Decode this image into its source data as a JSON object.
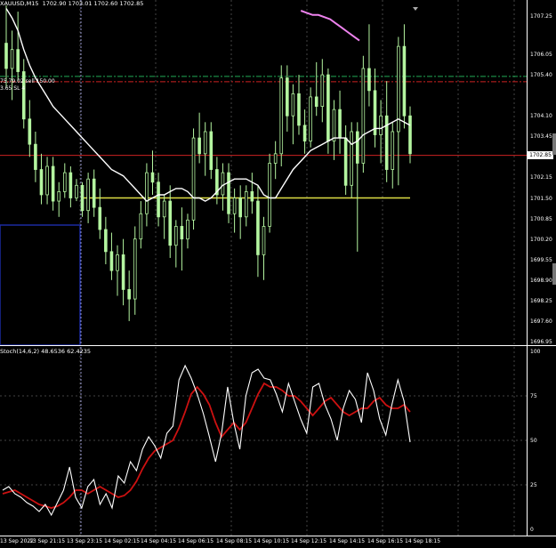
{
  "window": {
    "symbol_title": "XAUUSD,M15",
    "ohlc": "1702.90 1703.01 1702.60 1702.85"
  },
  "trade_labels": {
    "tp_label": "75.79.02 sell 150.00",
    "sl_label": "3.65 SL 4"
  },
  "price_axis": {
    "ticks": [
      "1707.25",
      "1706.05",
      "1705.40",
      "1704.10",
      "1703.45",
      "1702.15",
      "1701.50",
      "1700.85",
      "1700.20",
      "1699.55",
      "1698.90",
      "1698.25",
      "1697.60",
      "1696.95"
    ],
    "current_price": "1702.85",
    "range": [
      1696.95,
      1707.6
    ]
  },
  "oscillator": {
    "title": "Stoch(14,6,2) 48.6536 62.4235",
    "ticks": [
      "100",
      "75",
      "50",
      "25",
      "0"
    ]
  },
  "time_axis": {
    "ticks": [
      "13 Sep 2022",
      "13 Sep 21:15",
      "13 Sep 23:15",
      "14 Sep 02:15",
      "14 Sep 04:15",
      "14 Sep 06:15",
      "14 Sep 08:15",
      "14 Sep 10:15",
      "14 Sep 12:15",
      "14 Sep 14:15",
      "14 Sep 16:15",
      "14 Sep 18:15"
    ]
  },
  "colors": {
    "bull_candle": "#b4f5a0",
    "ma_line": "#ffffff",
    "ma_upper": "#ee82ee",
    "tp_line": "#22aa55",
    "sl_line": "#cc2222",
    "price_line": "#cc2222",
    "support_line": "#dddd44",
    "stoch_main": "#ffffff",
    "stoch_signal": "#cc1111",
    "grid": "#888888",
    "blue_box": "#1a2aa0"
  },
  "chart_data": {
    "type": "candlestick",
    "candles": [
      {
        "o": 1706.4,
        "h": 1707.6,
        "l": 1705.0,
        "c": 1705.6
      },
      {
        "o": 1705.6,
        "h": 1706.8,
        "l": 1704.6,
        "c": 1706.2
      },
      {
        "o": 1706.2,
        "h": 1707.4,
        "l": 1705.2,
        "c": 1705.5
      },
      {
        "o": 1705.5,
        "h": 1705.9,
        "l": 1703.7,
        "c": 1704.0
      },
      {
        "o": 1704.0,
        "h": 1704.6,
        "l": 1702.8,
        "c": 1703.2
      },
      {
        "o": 1703.2,
        "h": 1703.6,
        "l": 1702.0,
        "c": 1702.4
      },
      {
        "o": 1702.4,
        "h": 1702.9,
        "l": 1701.3,
        "c": 1701.6
      },
      {
        "o": 1701.6,
        "h": 1702.8,
        "l": 1701.3,
        "c": 1702.5
      },
      {
        "o": 1702.5,
        "h": 1702.8,
        "l": 1701.1,
        "c": 1701.4
      },
      {
        "o": 1701.4,
        "h": 1702.0,
        "l": 1700.9,
        "c": 1701.7
      },
      {
        "o": 1701.7,
        "h": 1702.6,
        "l": 1701.5,
        "c": 1702.3
      },
      {
        "o": 1702.3,
        "h": 1702.5,
        "l": 1701.2,
        "c": 1701.5
      },
      {
        "o": 1701.5,
        "h": 1702.1,
        "l": 1701.4,
        "c": 1701.9
      },
      {
        "o": 1701.9,
        "h": 1702.0,
        "l": 1700.9,
        "c": 1701.1
      },
      {
        "o": 1701.1,
        "h": 1702.3,
        "l": 1700.7,
        "c": 1702.1
      },
      {
        "o": 1702.1,
        "h": 1702.4,
        "l": 1700.9,
        "c": 1701.2
      },
      {
        "o": 1701.2,
        "h": 1701.8,
        "l": 1700.2,
        "c": 1700.5
      },
      {
        "o": 1700.5,
        "h": 1700.9,
        "l": 1699.4,
        "c": 1699.8
      },
      {
        "o": 1699.8,
        "h": 1700.4,
        "l": 1698.9,
        "c": 1699.2
      },
      {
        "o": 1699.2,
        "h": 1700.0,
        "l": 1698.4,
        "c": 1699.7
      },
      {
        "o": 1699.7,
        "h": 1700.2,
        "l": 1698.1,
        "c": 1698.6
      },
      {
        "o": 1698.6,
        "h": 1699.2,
        "l": 1697.6,
        "c": 1698.3
      },
      {
        "o": 1698.3,
        "h": 1700.6,
        "l": 1697.8,
        "c": 1700.2
      },
      {
        "o": 1700.2,
        "h": 1701.4,
        "l": 1699.9,
        "c": 1701.0
      },
      {
        "o": 1701.0,
        "h": 1702.6,
        "l": 1700.6,
        "c": 1702.3
      },
      {
        "o": 1702.3,
        "h": 1703.0,
        "l": 1701.6,
        "c": 1702.0
      },
      {
        "o": 1702.0,
        "h": 1702.3,
        "l": 1700.6,
        "c": 1700.9
      },
      {
        "o": 1700.9,
        "h": 1701.6,
        "l": 1700.2,
        "c": 1701.4
      },
      {
        "o": 1701.4,
        "h": 1701.9,
        "l": 1699.6,
        "c": 1700.0
      },
      {
        "o": 1700.0,
        "h": 1700.8,
        "l": 1699.3,
        "c": 1700.6
      },
      {
        "o": 1700.6,
        "h": 1701.2,
        "l": 1699.2,
        "c": 1700.2
      },
      {
        "o": 1700.2,
        "h": 1701.0,
        "l": 1699.9,
        "c": 1700.8
      },
      {
        "o": 1700.8,
        "h": 1703.7,
        "l": 1700.5,
        "c": 1703.4
      },
      {
        "o": 1703.4,
        "h": 1704.2,
        "l": 1702.6,
        "c": 1702.9
      },
      {
        "o": 1702.9,
        "h": 1703.9,
        "l": 1702.2,
        "c": 1703.6
      },
      {
        "o": 1703.6,
        "h": 1703.9,
        "l": 1702.1,
        "c": 1702.4
      },
      {
        "o": 1702.4,
        "h": 1702.8,
        "l": 1701.3,
        "c": 1701.6
      },
      {
        "o": 1701.6,
        "h": 1702.6,
        "l": 1701.1,
        "c": 1702.3
      },
      {
        "o": 1702.3,
        "h": 1702.6,
        "l": 1700.7,
        "c": 1701.0
      },
      {
        "o": 1701.0,
        "h": 1701.8,
        "l": 1700.4,
        "c": 1701.5
      },
      {
        "o": 1701.5,
        "h": 1701.9,
        "l": 1700.2,
        "c": 1700.9
      },
      {
        "o": 1700.9,
        "h": 1701.9,
        "l": 1700.6,
        "c": 1701.7
      },
      {
        "o": 1701.7,
        "h": 1702.3,
        "l": 1701.0,
        "c": 1701.4
      },
      {
        "o": 1701.4,
        "h": 1701.9,
        "l": 1699.0,
        "c": 1699.7
      },
      {
        "o": 1699.7,
        "h": 1700.9,
        "l": 1698.9,
        "c": 1700.6
      },
      {
        "o": 1700.6,
        "h": 1702.9,
        "l": 1700.4,
        "c": 1702.6
      },
      {
        "o": 1702.6,
        "h": 1703.3,
        "l": 1702.1,
        "c": 1702.9
      },
      {
        "o": 1702.9,
        "h": 1705.7,
        "l": 1702.5,
        "c": 1705.3
      },
      {
        "o": 1705.3,
        "h": 1705.7,
        "l": 1703.6,
        "c": 1704.1
      },
      {
        "o": 1704.1,
        "h": 1705.1,
        "l": 1703.2,
        "c": 1704.8
      },
      {
        "o": 1704.8,
        "h": 1705.4,
        "l": 1703.5,
        "c": 1703.8
      },
      {
        "o": 1703.8,
        "h": 1704.3,
        "l": 1702.9,
        "c": 1703.3
      },
      {
        "o": 1703.3,
        "h": 1705.0,
        "l": 1703.1,
        "c": 1704.7
      },
      {
        "o": 1704.7,
        "h": 1705.8,
        "l": 1704.1,
        "c": 1704.4
      },
      {
        "o": 1704.4,
        "h": 1705.9,
        "l": 1703.9,
        "c": 1705.4
      },
      {
        "o": 1705.4,
        "h": 1705.6,
        "l": 1702.9,
        "c": 1703.3
      },
      {
        "o": 1703.3,
        "h": 1704.6,
        "l": 1702.7,
        "c": 1704.3
      },
      {
        "o": 1704.3,
        "h": 1704.9,
        "l": 1702.9,
        "c": 1703.4
      },
      {
        "o": 1703.4,
        "h": 1703.8,
        "l": 1701.6,
        "c": 1701.9
      },
      {
        "o": 1701.9,
        "h": 1703.9,
        "l": 1701.5,
        "c": 1703.6
      },
      {
        "o": 1703.6,
        "h": 1703.9,
        "l": 1699.8,
        "c": 1702.6
      },
      {
        "o": 1702.6,
        "h": 1706.0,
        "l": 1702.3,
        "c": 1705.6
      },
      {
        "o": 1705.6,
        "h": 1707.0,
        "l": 1704.4,
        "c": 1704.9
      },
      {
        "o": 1704.9,
        "h": 1705.6,
        "l": 1703.1,
        "c": 1703.5
      },
      {
        "o": 1703.5,
        "h": 1704.6,
        "l": 1702.6,
        "c": 1704.1
      },
      {
        "o": 1704.1,
        "h": 1705.2,
        "l": 1702.0,
        "c": 1702.4
      },
      {
        "o": 1702.4,
        "h": 1703.9,
        "l": 1701.8,
        "c": 1703.6
      },
      {
        "o": 1703.6,
        "h": 1706.6,
        "l": 1701.9,
        "c": 1706.3
      },
      {
        "o": 1706.3,
        "h": 1707.0,
        "l": 1703.7,
        "c": 1704.1
      },
      {
        "o": 1704.1,
        "h": 1704.4,
        "l": 1702.6,
        "c": 1702.9
      }
    ],
    "ma": [
      1707.5,
      1707.2,
      1706.8,
      1706.2,
      1705.7,
      1705.3,
      1705.0,
      1704.7,
      1704.4,
      1704.2,
      1704.0,
      1703.8,
      1703.6,
      1703.4,
      1703.2,
      1703.0,
      1702.8,
      1702.6,
      1702.4,
      1702.3,
      1702.2,
      1702.0,
      1701.8,
      1701.6,
      1701.4,
      1701.5,
      1701.6,
      1701.6,
      1701.7,
      1701.8,
      1701.8,
      1701.7,
      1701.5,
      1701.5,
      1701.4,
      1701.5,
      1701.7,
      1701.9,
      1702.0,
      1702.1,
      1702.1,
      1702.1,
      1702.0,
      1701.9,
      1701.6,
      1701.5,
      1701.5,
      1701.8,
      1702.1,
      1702.4,
      1702.6,
      1702.8,
      1703.0,
      1703.1,
      1703.2,
      1703.3,
      1703.4,
      1703.4,
      1703.4,
      1703.2,
      1703.3,
      1703.5,
      1703.6,
      1703.7,
      1703.7,
      1703.8,
      1703.9,
      1704.0,
      1703.9,
      1703.8
    ],
    "ma_upper": [
      null,
      null,
      null,
      null,
      null,
      null,
      null,
      null,
      null,
      null,
      null,
      null,
      null,
      null,
      null,
      null,
      null,
      null,
      null,
      null,
      null,
      null,
      null,
      null,
      null,
      null,
      null,
      null,
      null,
      null,
      null,
      null,
      null,
      null,
      null,
      null,
      null,
      null,
      null,
      null,
      null,
      null,
      null,
      null,
      null,
      null,
      null,
      null,
      null,
      null,
      null,
      null,
      null,
      null,
      null,
      null,
      null,
      null,
      null,
      1707.9,
      1707.85,
      1707.8,
      1707.8,
      1707.75,
      1707.7,
      1707.6,
      1707.5,
      1707.4,
      1707.3,
      1707.2
    ],
    "levels": {
      "tp": 1705.35,
      "sl": 1705.18,
      "current": 1702.85,
      "support": 1701.5
    },
    "stoch_main": [
      22,
      24,
      20,
      18,
      15,
      13,
      10,
      14,
      8,
      15,
      22,
      35,
      18,
      12,
      24,
      28,
      14,
      20,
      12,
      30,
      26,
      38,
      33,
      45,
      52,
      47,
      40,
      54,
      58,
      84,
      92,
      85,
      76,
      65,
      52,
      38,
      54,
      80,
      60,
      45,
      75,
      88,
      90,
      85,
      84,
      76,
      66,
      82,
      72,
      62,
      54,
      80,
      82,
      70,
      62,
      50,
      68,
      78,
      73,
      60,
      88,
      78,
      62,
      53,
      70,
      84,
      72,
      49
    ],
    "stoch_signal": [
      20,
      21,
      22,
      20,
      18,
      16,
      14,
      13,
      12,
      13,
      15,
      18,
      22,
      22,
      20,
      22,
      24,
      22,
      20,
      18,
      19,
      22,
      27,
      34,
      40,
      44,
      46,
      48,
      50,
      57,
      66,
      76,
      80,
      76,
      70,
      60,
      52,
      56,
      60,
      56,
      60,
      68,
      76,
      82,
      80,
      80,
      78,
      75,
      75,
      72,
      68,
      64,
      68,
      72,
      74,
      70,
      66,
      64,
      66,
      68,
      68,
      72,
      74,
      70,
      68,
      68,
      70,
      66
    ]
  }
}
